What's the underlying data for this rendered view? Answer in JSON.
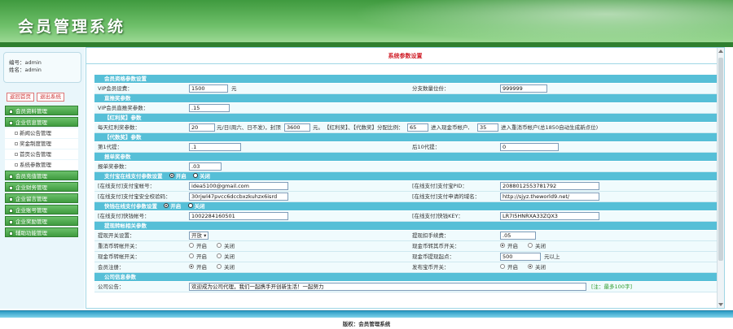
{
  "app": {
    "title": "会员管理系统"
  },
  "user": {
    "id_label": "编号：",
    "id_value": "admin",
    "name_label": "姓名：",
    "name_value": "admin"
  },
  "side_buttons": [
    "返回首页",
    "退出系统"
  ],
  "menu": {
    "items": [
      "会员资料管理",
      "企业信息管理"
    ],
    "subitems": [
      "新闻公告管理",
      "奖金制度管理",
      "首页公告管理",
      "系统参数管理"
    ],
    "items2": [
      "会员充值管理",
      "企业财务管理",
      "企业留言管理",
      "企业账号管理",
      "企业奖励管理",
      "辅助功能管理"
    ]
  },
  "page": {
    "title": "系统参数设置"
  },
  "sections": {
    "s1": "会员资格参数设置",
    "s2": "直推奖参数",
    "s3": "【红利奖】参数",
    "s4": "【代数奖】参数",
    "s5": "报单奖参数",
    "s6": "支付宝在线支付参数设置",
    "s6_on": "开启",
    "s6_off": "关闭",
    "s7": "快钱在线支付参数设置",
    "s7_on": "开启",
    "s7_off": "关闭",
    "s8": "提现转帐相关参数",
    "s9": "公司信息参数"
  },
  "rows": {
    "vip_label": "VIP会员设费：",
    "vip_value": "1500",
    "vip_unit": "元",
    "nest_label": "分支数量位份：",
    "nest_value": "999999",
    "direct_label": "VIP会员直推奖参数：",
    "direct_value": ".15",
    "bonus_label": "每天红利奖参数：",
    "bonus_value": "20",
    "bonus_mid": "元/日(周六、日不发)，封顶",
    "bonus_cap": "3600",
    "bonus_cap_unit": "元。",
    "bonus_note": "【红利奖】、【代数奖】分配比例：",
    "bonus_ratio1": "65",
    "bonus_mid2": "进入现金币帐户,",
    "bonus_ratio2": "35",
    "bonus_end": "进入重消币帐户(总1850自动生成新点位)",
    "gen1_label": "第1代提：",
    "gen1_value": ".1",
    "gen10_label": "后10代提：",
    "gen10_value": "0",
    "report_label": "报单奖参数：",
    "report_value": ".03",
    "alipay_acc_label": "[在线支付]支付宝帐号：",
    "alipay_acc_value": "idea5100@gmail.com",
    "alipay_pid_label": "[在线支付]支付宝PID：",
    "alipay_pid_value": "2088012553781792",
    "alipay_key_label": "[在线支付]支付宝安全校验码：",
    "alipay_key_value": "30rjwl47pvcc6dccbxzkuhzx6isrd",
    "alipay_domain_label": "[在线支付]支付申请的域名：",
    "alipay_domain_value": "http://sjyz.theworld9.net/",
    "kq_acc_label": "[在线支付]快钱帐号：",
    "kq_acc_value": "1002284160501",
    "kq_key_label": "[在线支付]快钱KEY：",
    "kq_key_value": "LR7I5HNRXA33ZQX3",
    "wd_switch_label": "提现开关设置：",
    "wd_switch_value": "开放",
    "wd_fee_label": "提现扣手续费：",
    "wd_fee_value": ".05",
    "reconsume_label": "重消币转帐开关：",
    "cash_tr_label": "现金币转其币开关：",
    "cash_sw_label": "现金币转帐开关：",
    "cash_min_label": "现金币提现起点：",
    "cash_min_value": "500",
    "cash_min_unit": "元以上",
    "reg_label": "会员注册：",
    "bingo_label": "发布宝币开关：",
    "on": "开启",
    "off": "关闭",
    "notice_label": "公司公告：",
    "notice_value": "欢迎成为公司代理，我们一起携手开创新生活！一起努力",
    "notice_note": "[注：最多100字]"
  },
  "footer": {
    "text": "版权：会员管理系统"
  }
}
